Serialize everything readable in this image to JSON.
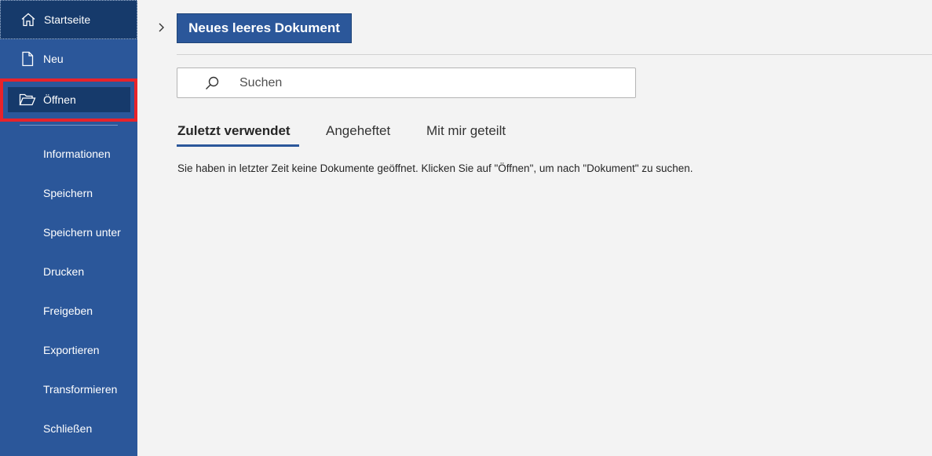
{
  "sidebar": {
    "items": [
      {
        "label": "Startseite",
        "icon": "home-icon"
      },
      {
        "label": "Neu",
        "icon": "new-document-icon"
      },
      {
        "label": "Öffnen",
        "icon": "open-folder-icon"
      },
      {
        "label": "Informationen"
      },
      {
        "label": "Speichern"
      },
      {
        "label": "Speichern unter"
      },
      {
        "label": "Drucken"
      },
      {
        "label": "Freigeben"
      },
      {
        "label": "Exportieren"
      },
      {
        "label": "Transformieren"
      },
      {
        "label": "Schließen"
      }
    ]
  },
  "main": {
    "new_document_label": "Neues leeres Dokument",
    "search": {
      "placeholder": "Suchen",
      "icon": "search-icon"
    },
    "tabs": [
      {
        "label": "Zuletzt verwendet",
        "active": true
      },
      {
        "label": "Angeheftet",
        "active": false
      },
      {
        "label": "Mit mir geteilt",
        "active": false
      }
    ],
    "empty_message": "Sie haben in letzter Zeit keine Dokumente geöffnet. Klicken Sie auf \"Öffnen\", um nach \"Dokument\" zu suchen."
  },
  "colors": {
    "sidebar_bg": "#2b579a",
    "sidebar_selected_bg": "#163a6b",
    "highlight_frame": "#e8232a",
    "page_bg": "#f3f3f3"
  }
}
